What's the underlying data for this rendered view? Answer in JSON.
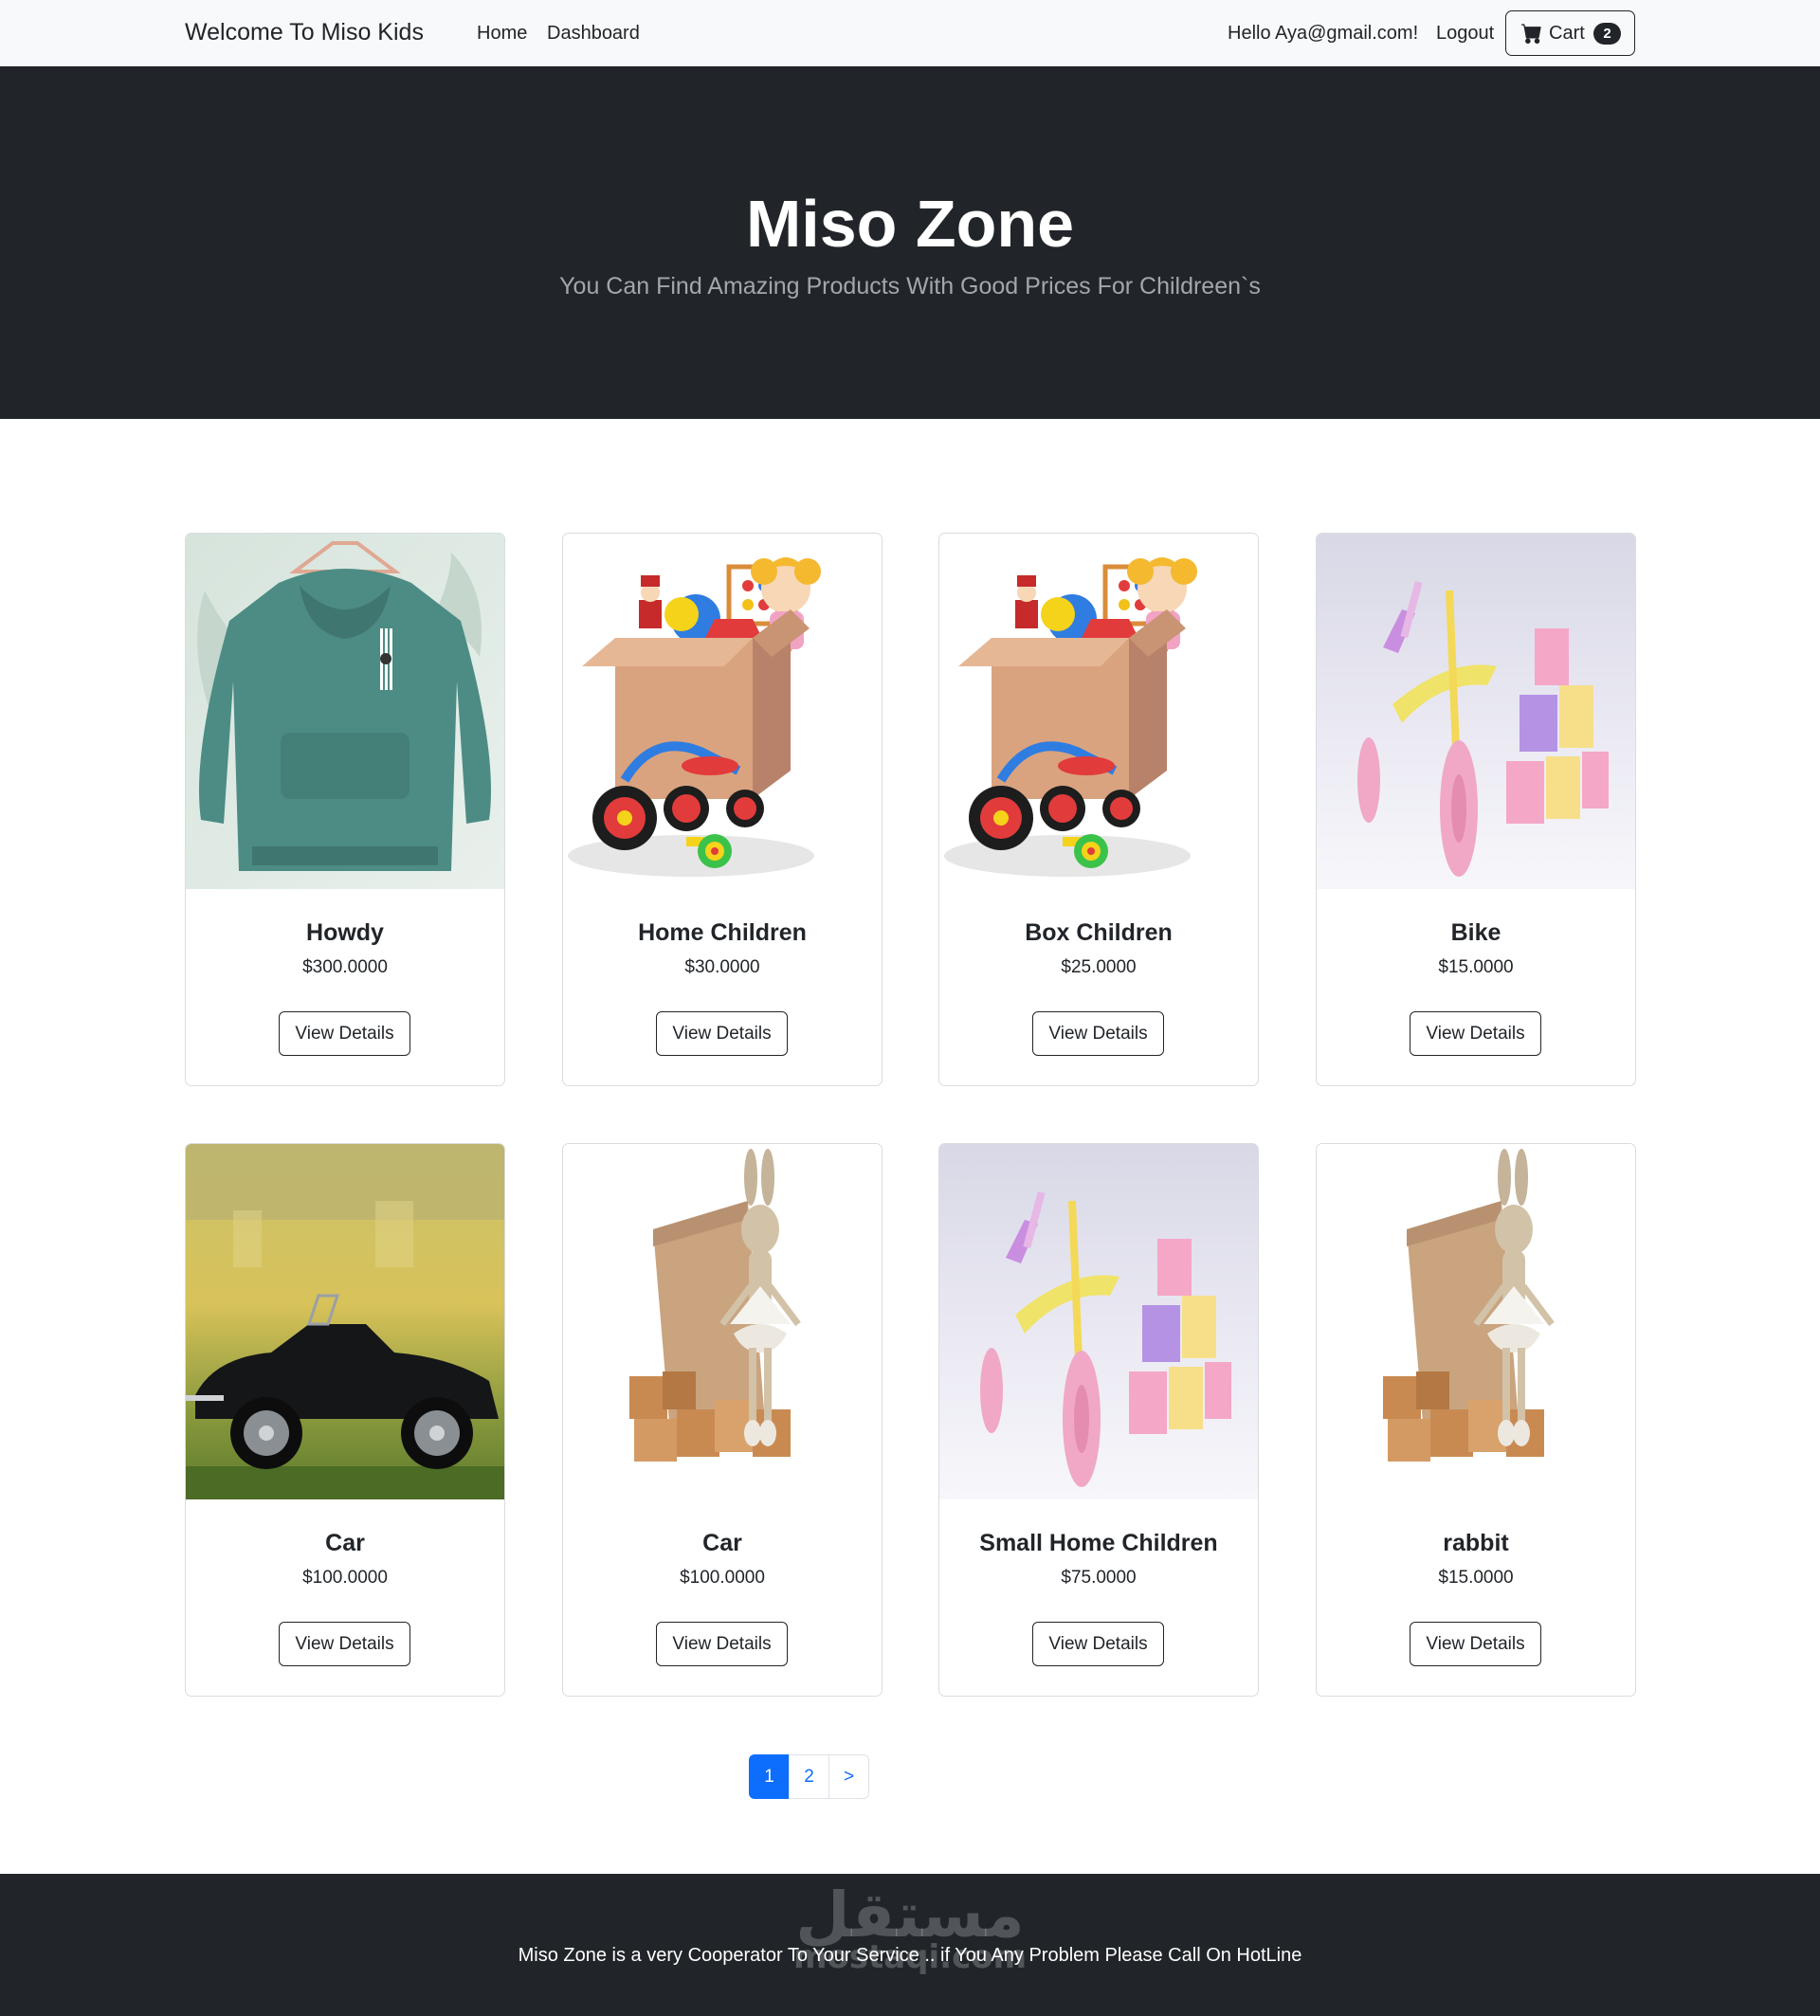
{
  "navbar": {
    "brand": "Welcome To Miso Kids",
    "links": [
      "Home",
      "Dashboard"
    ],
    "greeting": "Hello Aya@gmail.com!",
    "logout": "Logout",
    "cart_label": "Cart",
    "cart_count": "2"
  },
  "hero": {
    "title": "Miso Zone",
    "subtitle": "You Can Find Amazing Products With Good Prices For Childreen`s"
  },
  "products": [
    {
      "name": "Howdy",
      "price": "$300.0000",
      "button": "View Details",
      "image": "hoodie"
    },
    {
      "name": "Home Children",
      "price": "$30.0000",
      "button": "View Details",
      "image": "toy-box"
    },
    {
      "name": "Box Children",
      "price": "$25.0000",
      "button": "View Details",
      "image": "toy-box"
    },
    {
      "name": "Bike",
      "price": "$15.0000",
      "button": "View Details",
      "image": "balance-bike"
    },
    {
      "name": "Car",
      "price": "$100.0000",
      "button": "View Details",
      "image": "vintage-car"
    },
    {
      "name": "Car",
      "price": "$100.0000",
      "button": "View Details",
      "image": "rabbit-doll"
    },
    {
      "name": "Small Home Children",
      "price": "$75.0000",
      "button": "View Details",
      "image": "balance-bike"
    },
    {
      "name": "rabbit",
      "price": "$15.0000",
      "button": "View Details",
      "image": "rabbit-doll"
    }
  ],
  "pagination": {
    "pages": [
      "1",
      "2",
      ">"
    ],
    "active": "1"
  },
  "footer": {
    "text": "Miso Zone is a very Cooperator To Your Service .. if You Any Problem Please Call On HotLine",
    "watermark_arabic": "مستقل",
    "watermark_latin": "mostaqi.com"
  },
  "colors": {
    "dark": "#212529",
    "light": "#f8f9fa",
    "primary": "#0d6efd",
    "subtitle": "#a2a7ad"
  },
  "icons": {
    "cart": "cart-icon"
  }
}
